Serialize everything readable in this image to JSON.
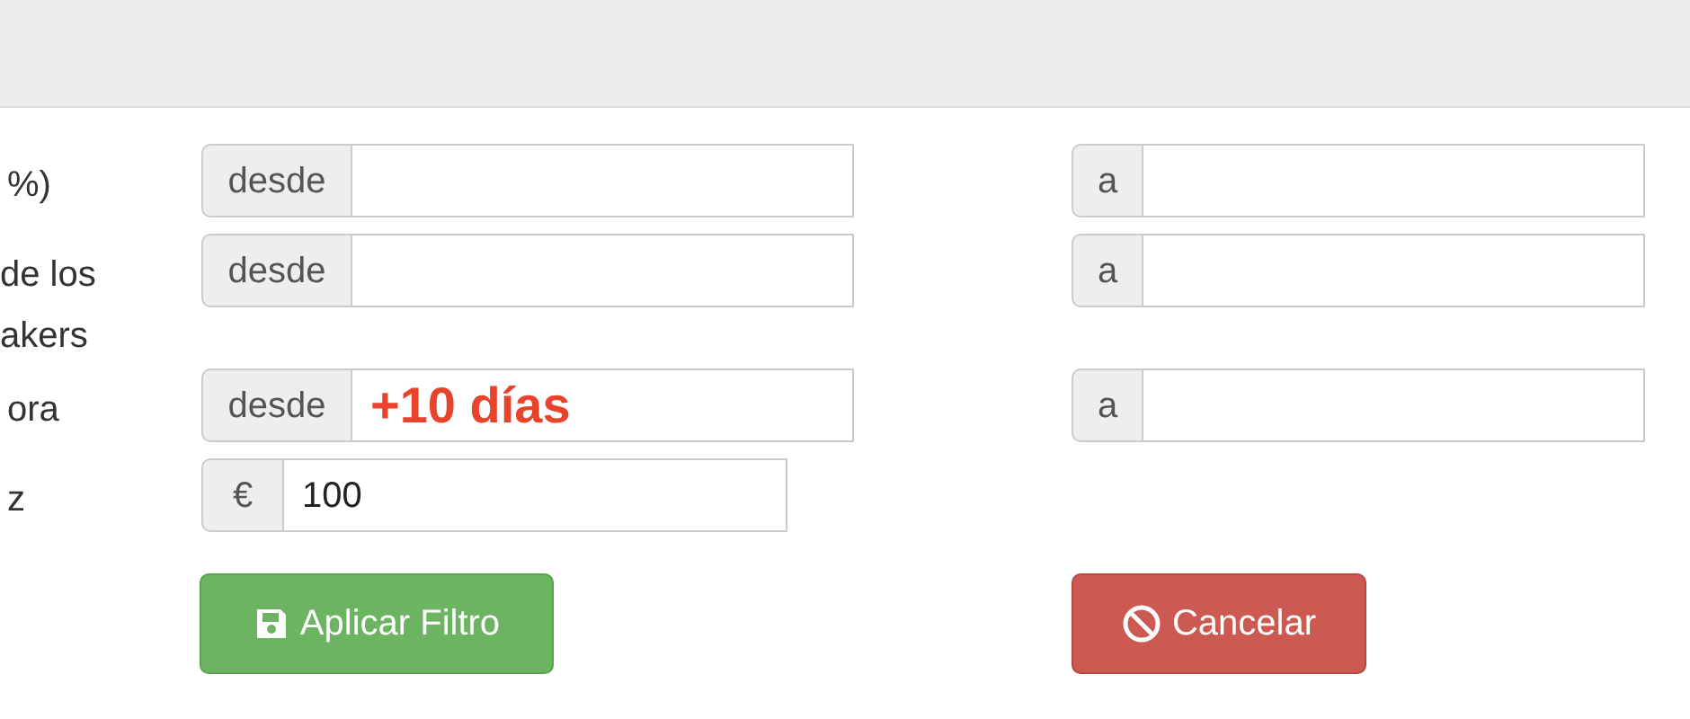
{
  "rows": [
    {
      "label_lines": [
        "%)"
      ],
      "from_addon": "desde",
      "from_value": "",
      "to_addon": "a",
      "to_value": ""
    },
    {
      "label_lines": [
        "de los",
        "akers"
      ],
      "from_addon": "desde",
      "from_value": "",
      "to_addon": "a",
      "to_value": ""
    },
    {
      "label_lines": [
        "ora"
      ],
      "from_addon": "desde",
      "from_value": "",
      "from_note": "+10 días",
      "to_addon": "a",
      "to_value": ""
    },
    {
      "label_lines": [
        "z"
      ],
      "from_addon": "€",
      "from_value": "100"
    }
  ],
  "buttons": [
    {
      "label": "Aplicar Filtro",
      "kind": "primary"
    },
    {
      "label": "Cancelar",
      "kind": "cancel"
    }
  ]
}
